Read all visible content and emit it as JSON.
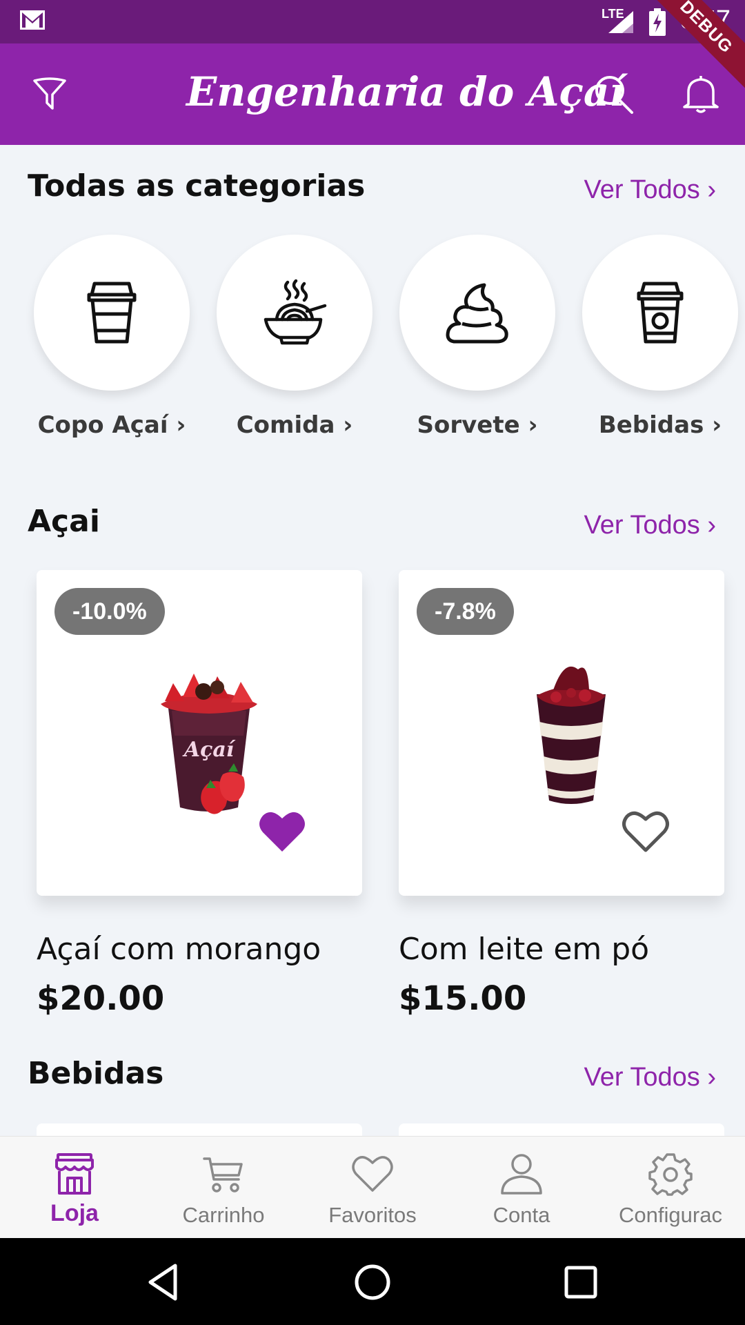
{
  "status_bar": {
    "network": "LTE",
    "time": "6:57",
    "debug_label": "DEBUG"
  },
  "app_bar": {
    "title": "Engenharia do Açaí"
  },
  "categories_section": {
    "title": "Todas as categorias",
    "see_all": "Ver Todos ›",
    "items": [
      {
        "label": "Copo Açaí ›",
        "icon": "cup-icon"
      },
      {
        "label": "Comida ›",
        "icon": "bowl-icon"
      },
      {
        "label": "Sorvete ›",
        "icon": "ice-cream-icon"
      },
      {
        "label": "Bebidas ›",
        "icon": "drink-icon"
      }
    ]
  },
  "acai_section": {
    "title": "Açai",
    "see_all": "Ver Todos ›",
    "products": [
      {
        "discount": "-10.0%",
        "name": "Açaí com morango",
        "price": "$20.00",
        "favorite": true
      },
      {
        "discount": "-7.8%",
        "name": "Com leite em pó",
        "price": "$15.00",
        "favorite": false
      }
    ]
  },
  "bebidas_section": {
    "title": "Bebidas",
    "see_all": "Ver Todos ›"
  },
  "bottom_nav": {
    "items": [
      {
        "label": "Loja",
        "icon": "store-icon",
        "active": true
      },
      {
        "label": "Carrinho",
        "icon": "cart-icon",
        "active": false
      },
      {
        "label": "Favoritos",
        "icon": "heart-icon",
        "active": false
      },
      {
        "label": "Conta",
        "icon": "person-icon",
        "active": false
      },
      {
        "label": "Configurac",
        "icon": "gear-icon",
        "active": false
      }
    ]
  },
  "colors": {
    "primary": "#8e24aa",
    "status_bar": "#6a1b7a",
    "badge": "#757575",
    "background": "#f1f4f8"
  }
}
